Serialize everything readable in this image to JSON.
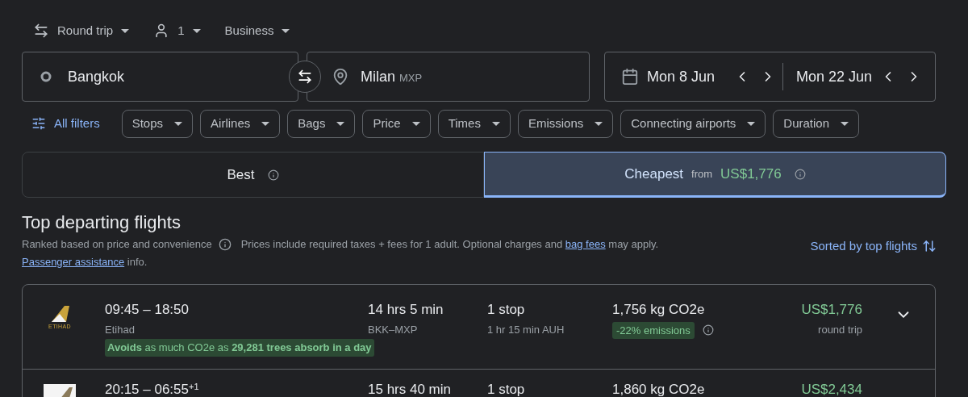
{
  "trip_options": [
    {
      "kind": "trip",
      "label": "Round trip"
    },
    {
      "kind": "passengers",
      "label": "1"
    },
    {
      "kind": "cabin",
      "label": "Business"
    }
  ],
  "search": {
    "origin": "Bangkok",
    "destination": "Milan",
    "destination_code": "MXP",
    "departure_date": "Mon 8 Jun",
    "return_date": "Mon 22 Jun"
  },
  "filters": {
    "all_filters": "All filters",
    "chips": [
      "Stops",
      "Airlines",
      "Bags",
      "Price",
      "Times",
      "Emissions",
      "Connecting airports",
      "Duration"
    ]
  },
  "tabs": [
    {
      "label": "Best",
      "selected": false
    },
    {
      "label": "Cheapest",
      "selected": true,
      "from": "from",
      "price": "US$1,776"
    }
  ],
  "results": {
    "title": "Top departing flights",
    "ranking_note": "Ranked based on price and convenience",
    "prices_note": {
      "before": "Prices include required taxes + fees for 1 adult. Optional charges and",
      "link": "bag fees",
      "after": "may apply."
    },
    "assistance": {
      "link": "Passenger assistance",
      "after": "info."
    },
    "sort": "Sorted by top flights"
  },
  "flights": [
    {
      "kind": "gold-logo",
      "logo_text": "ETIHAD",
      "times": "09:45 – 18:50",
      "airline": "Etihad",
      "eco_note": "**Avoids** as much CO2e as **29,281 trees absorb in a day**",
      "duration": "14 hrs 5 min",
      "route": "BKK–MXP",
      "stops": "1 stop",
      "layover": "1 hr 15 min AUH",
      "emissions": "1,756 kg CO2e",
      "emissions_badge": "-22% emissions",
      "price": "US$1,776",
      "price_note": "round trip",
      "expand": true
    },
    {
      "kind": "white-logo",
      "times": "20:15 – 06:55",
      "next_day": "+1",
      "duration": "15 hrs 40 min",
      "stops": "1 stop",
      "emissions": "1,860 kg CO2e",
      "price": "US$2,434",
      "expand": false
    }
  ]
}
